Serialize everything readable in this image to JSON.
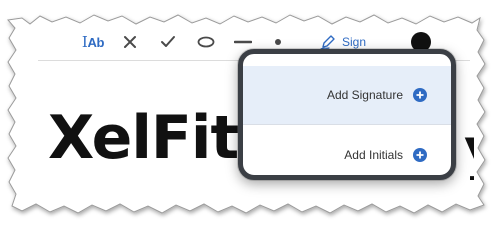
{
  "toolbar": {
    "text_field_tool_label": "Ab",
    "text_field_tool_prefix": "I",
    "sign_tool_label": "Sign",
    "tools": {
      "text_field": "text-field-icon",
      "cross": "cross-icon",
      "check": "checkmark-icon",
      "circle": "circle-icon",
      "line": "line-icon",
      "dot": "dot-icon",
      "sign": "pen-icon",
      "color": "color-swatch-icon"
    },
    "accent_color": "#2f6bc3",
    "selected_color": "#111111"
  },
  "document": {
    "visible_text": "XelFit",
    "trailing_glyph": "y"
  },
  "signature_menu": {
    "items": [
      {
        "label": "Add Signature",
        "icon": "plus-circle-icon"
      },
      {
        "label": "Add Initials",
        "icon": "plus-circle-icon"
      }
    ],
    "highlight_color": "#e6eef9",
    "frame_color": "#3b3f45"
  }
}
